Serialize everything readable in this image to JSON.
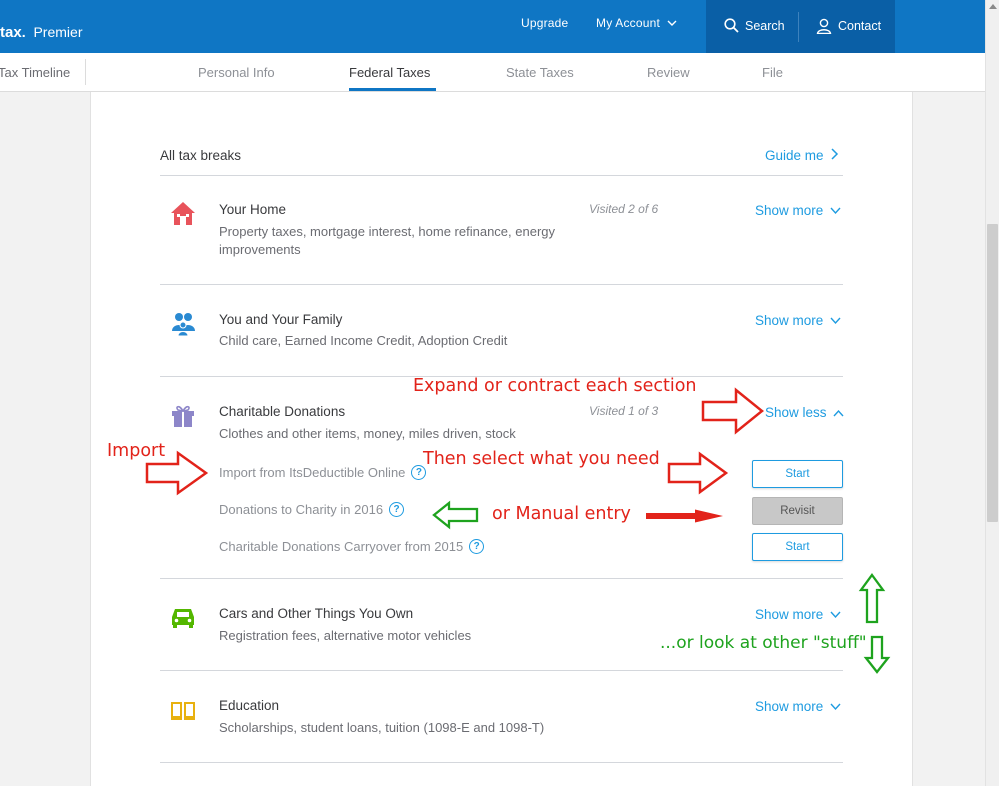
{
  "brand": {
    "name": "tax",
    "product": "Premier"
  },
  "topbar": {
    "upgrade": "Upgrade",
    "my_account": "My Account",
    "search": "Search",
    "contact": "Contact"
  },
  "subnav": {
    "timeline": "Tax Timeline",
    "tabs": [
      "Personal Info",
      "Federal Taxes",
      "State Taxes",
      "Review",
      "File"
    ],
    "active_tab": "Federal Taxes"
  },
  "header": {
    "title": "All tax breaks",
    "guide": "Guide me"
  },
  "sections": [
    {
      "title": "Your Home",
      "desc": "Property taxes, mortgage interest, home refinance, energy improvements",
      "visited": "Visited 2 of 6",
      "toggle": "Show more",
      "icon": "house-icon"
    },
    {
      "title": "You and Your Family",
      "desc": "Child care, Earned Income Credit, Adoption Credit",
      "visited": "",
      "toggle": "Show more",
      "icon": "family-icon"
    },
    {
      "title": "Charitable Donations",
      "desc": "Clothes and other items, money, miles driven, stock",
      "visited": "Visited 1 of 3",
      "toggle": "Show less",
      "icon": "gift-icon",
      "items": [
        {
          "label": "Import from ItsDeductible Online",
          "button": "Start"
        },
        {
          "label": "Donations to Charity in 2016",
          "button": "Revisit"
        },
        {
          "label": "Charitable Donations Carryover from 2015",
          "button": "Start"
        }
      ]
    },
    {
      "title": "Cars and Other Things You Own",
      "desc": "Registration fees, alternative motor vehicles",
      "visited": "",
      "toggle": "Show more",
      "icon": "car-icon"
    },
    {
      "title": "Education",
      "desc": "Scholarships, student loans, tuition (1098-E and 1098-T)",
      "visited": "",
      "toggle": "Show more",
      "icon": "book-icon"
    }
  ],
  "annotations": {
    "expand": "Expand or contract each section",
    "import": "Import",
    "select": "Then select what you need",
    "manual": "or Manual entry",
    "other": "...or look at other \"stuff\""
  },
  "colors": {
    "brand_blue": "#0f76c4",
    "link_blue": "#1e9be0",
    "annotation_red": "#e2231a",
    "annotation_green": "#1ea31e"
  }
}
